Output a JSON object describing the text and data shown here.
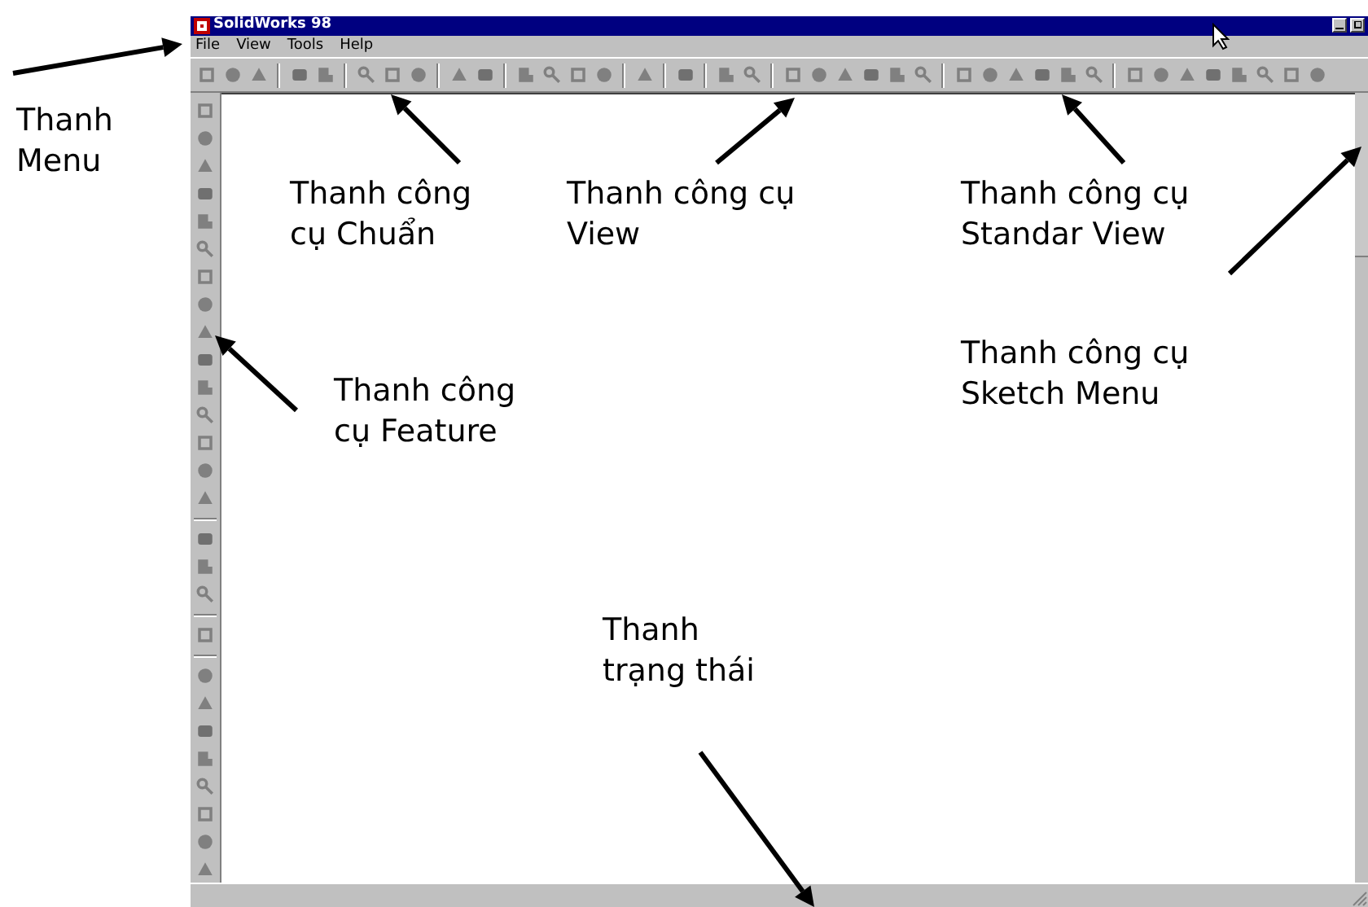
{
  "window": {
    "title": "SolidWorks 98"
  },
  "menu": [
    {
      "label": "File"
    },
    {
      "label": "View"
    },
    {
      "label": "Tools"
    },
    {
      "label": "Help"
    }
  ],
  "callouts": [
    {
      "lines": [
        "Thanh",
        "Menu"
      ]
    },
    {
      "lines": [
        "Thanh công",
        "cụ Chuẩn"
      ]
    },
    {
      "lines": [
        "Thanh công cụ",
        "View"
      ]
    },
    {
      "lines": [
        "Thanh công cụ",
        "Standar View"
      ]
    },
    {
      "lines": [
        "Thanh công cụ",
        "Sketch Menu"
      ]
    },
    {
      "lines": [
        "Thanh công",
        "cụ Feature"
      ]
    },
    {
      "lines": [
        "Thanh",
        "trạng thái"
      ]
    }
  ]
}
